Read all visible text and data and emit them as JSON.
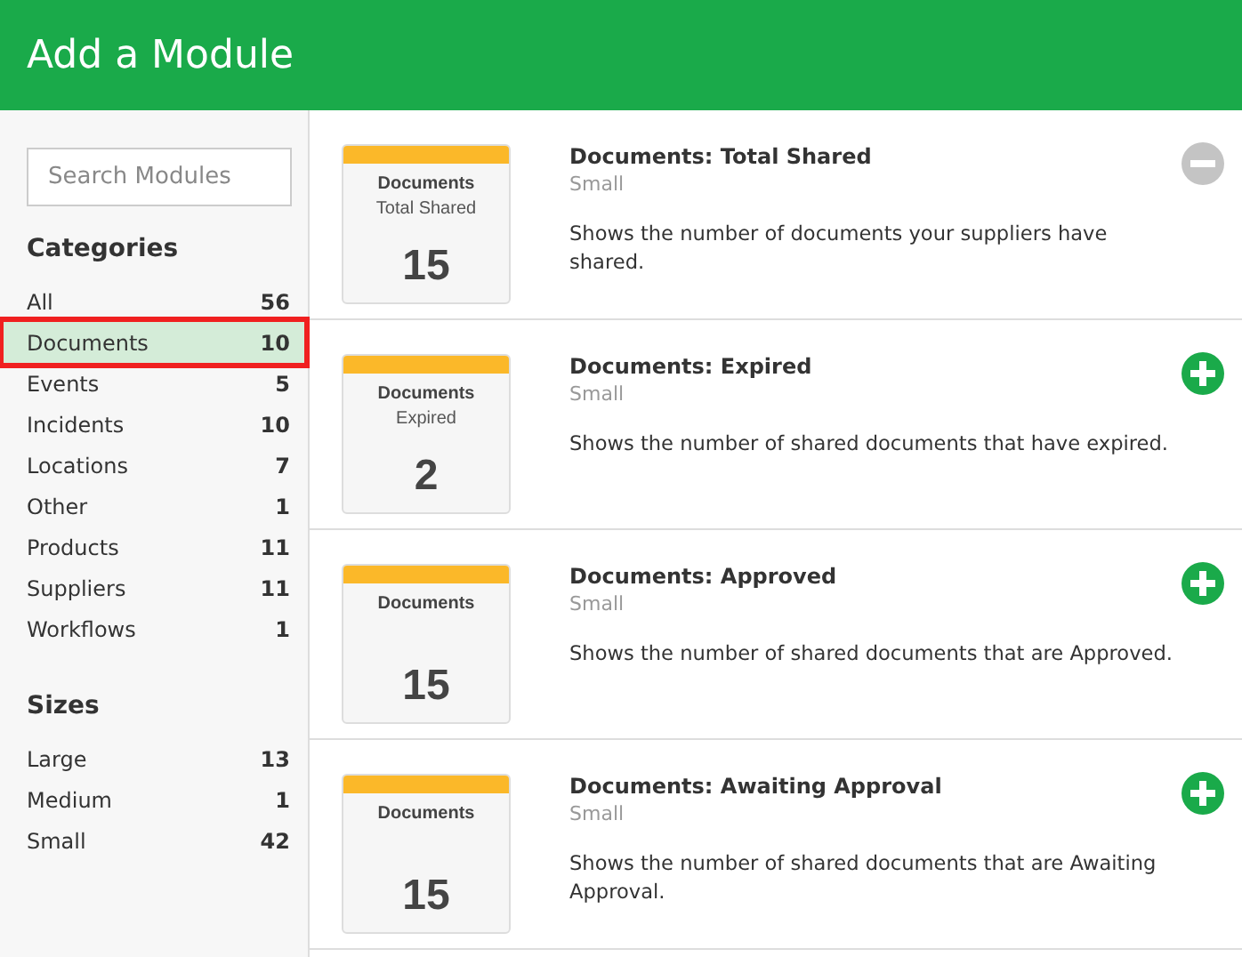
{
  "header": {
    "title": "Add a Module"
  },
  "sidebar": {
    "search": {
      "placeholder": "Search Modules"
    },
    "categories": {
      "heading": "Categories",
      "items": [
        {
          "label": "All",
          "count": "56",
          "selected": false
        },
        {
          "label": "Documents",
          "count": "10",
          "selected": true
        },
        {
          "label": "Events",
          "count": "5",
          "selected": false
        },
        {
          "label": "Incidents",
          "count": "10",
          "selected": false
        },
        {
          "label": "Locations",
          "count": "7",
          "selected": false
        },
        {
          "label": "Other",
          "count": "1",
          "selected": false
        },
        {
          "label": "Products",
          "count": "11",
          "selected": false
        },
        {
          "label": "Suppliers",
          "count": "11",
          "selected": false
        },
        {
          "label": "Workflows",
          "count": "1",
          "selected": false
        }
      ]
    },
    "sizes": {
      "heading": "Sizes",
      "items": [
        {
          "label": "Large",
          "count": "13",
          "selected": false
        },
        {
          "label": "Medium",
          "count": "1",
          "selected": false
        },
        {
          "label": "Small",
          "count": "42",
          "selected": false
        }
      ]
    }
  },
  "modules": [
    {
      "tile": {
        "category": "Documents",
        "subtitle": "Total Shared",
        "value": "15"
      },
      "title": "Documents: Total Shared",
      "size": "Small",
      "description": "Shows the number of documents your suppliers have shared.",
      "added": true
    },
    {
      "tile": {
        "category": "Documents",
        "subtitle": "Expired",
        "value": "2"
      },
      "title": "Documents: Expired",
      "size": "Small",
      "description": "Shows the number of shared documents that have expired.",
      "added": false
    },
    {
      "tile": {
        "category": "Documents",
        "value": "15"
      },
      "title": "Documents: Approved",
      "size": "Small",
      "description": "Shows the number of shared documents that are Approved.",
      "added": false
    },
    {
      "tile": {
        "category": "Documents",
        "value": "15"
      },
      "title": "Documents: Awaiting Approval",
      "size": "Small",
      "description": "Shows the number of shared documents that are Awaiting Approval.",
      "added": false
    }
  ]
}
